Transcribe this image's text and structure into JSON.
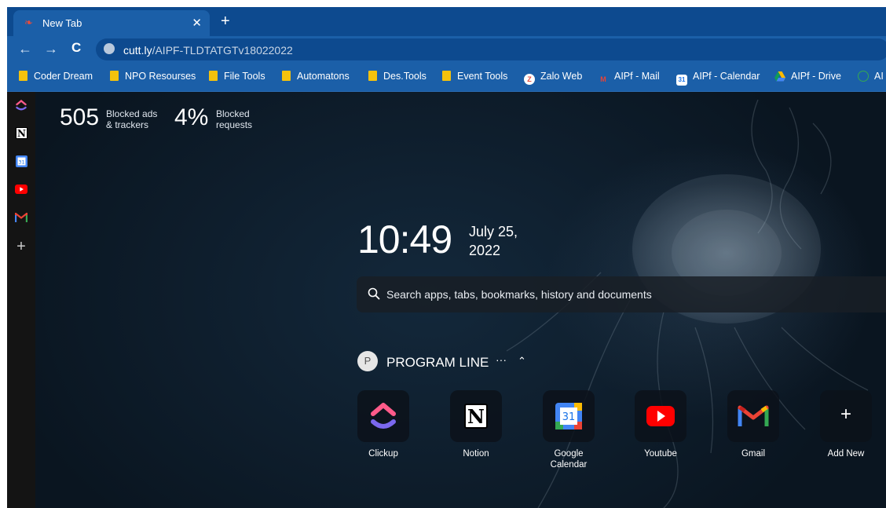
{
  "browser": {
    "tab": {
      "title": "New Tab",
      "close": "✕"
    },
    "new_tab": "+",
    "nav": {
      "back": "←",
      "forward": "→",
      "reload": "C"
    },
    "address": {
      "domain": "cutt.ly",
      "path": "/AIPF-TLDTATGTv18022022"
    }
  },
  "bookmarks": [
    {
      "label": "Coder Dream",
      "type": "folder"
    },
    {
      "label": "NPO Resourses",
      "type": "folder"
    },
    {
      "label": "File Tools",
      "type": "folder"
    },
    {
      "label": "Automatons",
      "type": "folder"
    },
    {
      "label": "Des.Tools",
      "type": "folder"
    },
    {
      "label": "Event Tools",
      "type": "folder"
    },
    {
      "label": "Zalo Web",
      "type": "site",
      "icon": "zalo-icon"
    },
    {
      "label": "AIPf - Mail",
      "type": "site",
      "icon": "gmail-icon"
    },
    {
      "label": "AIPf - Calendar",
      "type": "site",
      "icon": "calendar-icon"
    },
    {
      "label": "AIPf - Drive",
      "type": "site",
      "icon": "drive-icon"
    },
    {
      "label": "AI",
      "type": "site",
      "icon": "globe-icon"
    }
  ],
  "sidebar": [
    "clickup-icon",
    "notion-icon",
    "google-calendar-icon",
    "youtube-icon",
    "gmail-icon",
    "add-icon"
  ],
  "sidebar_add": "+",
  "stats": {
    "blocked_count": "505",
    "blocked_label_1": "Blocked ads",
    "blocked_label_2": "& trackers",
    "percent": "4%",
    "percent_label_1": "Blocked",
    "percent_label_2": "requests"
  },
  "clock": {
    "time": "10:49",
    "date_1": "July 25,",
    "date_2": "2022"
  },
  "search": {
    "placeholder": "Search apps, tabs, bookmarks, history and documents"
  },
  "group": {
    "avatar": "P",
    "name": "PROGRAM LINE",
    "more": "···",
    "collapse": "⌃"
  },
  "tiles": [
    {
      "label": "Clickup",
      "icon": "clickup-icon"
    },
    {
      "label": "Notion",
      "icon": "notion-icon"
    },
    {
      "label": "Google",
      "label_2": "Calendar",
      "icon": "google-calendar-icon"
    },
    {
      "label": "Youtube",
      "icon": "youtube-icon"
    },
    {
      "label": "Gmail",
      "icon": "gmail-icon"
    },
    {
      "label": "Add New",
      "icon": "add-icon",
      "glyph": "+"
    }
  ],
  "colors": {
    "chrome": "#1b5fa8",
    "tabstrip": "#0d4a8f",
    "sidebar": "#141414",
    "background": "#0b1622"
  }
}
